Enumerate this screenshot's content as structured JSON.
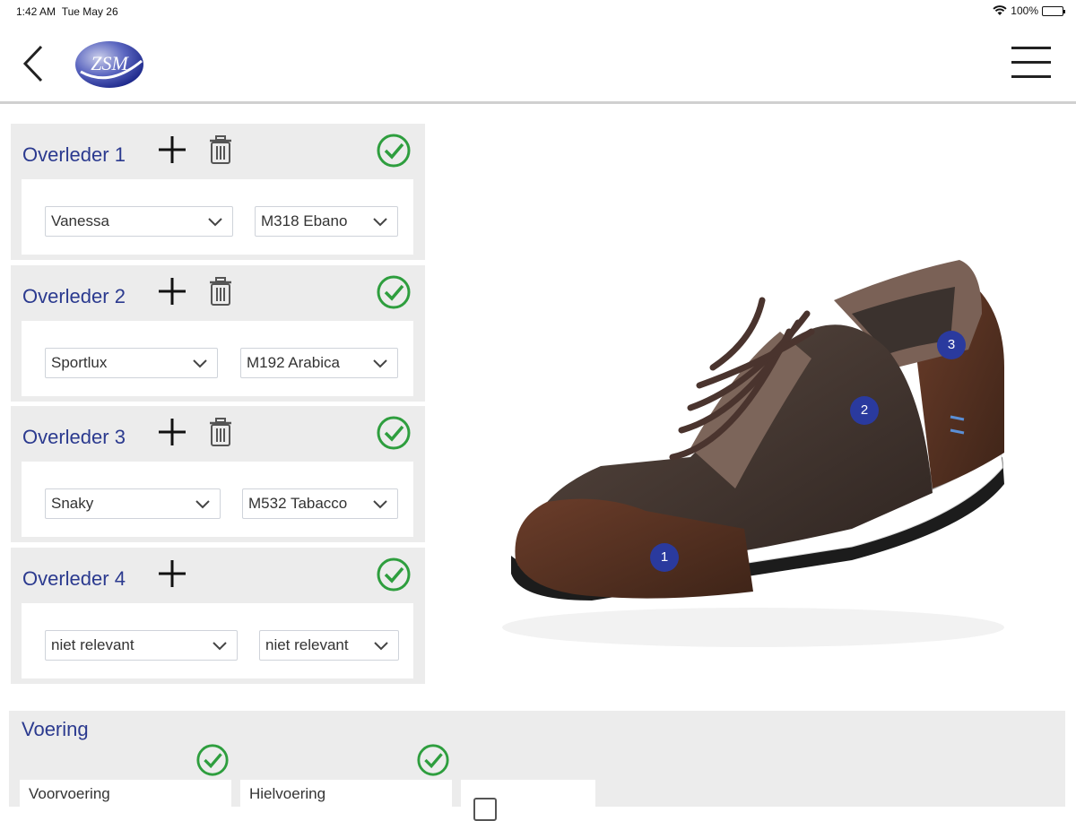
{
  "status_bar": {
    "time": "1:42 AM",
    "date": "Tue May 26",
    "battery": "100%"
  },
  "header": {
    "logo_text": "ZSM"
  },
  "panels": [
    {
      "title": "Overleder 1",
      "has_delete": true,
      "select_a": "Vanessa",
      "select_b": "M318 Ebano"
    },
    {
      "title": "Overleder 2",
      "has_delete": true,
      "select_a": "Sportlux",
      "select_b": "M192 Arabica"
    },
    {
      "title": "Overleder 3",
      "has_delete": true,
      "select_a": "Snaky",
      "select_b": "M532 Tabacco"
    },
    {
      "title": "Overleder 4",
      "has_delete": false,
      "select_a": "niet relevant",
      "select_b": "niet relevant"
    }
  ],
  "voering": {
    "title": "Voering",
    "cards": [
      "Voorvoering",
      "Hielvoering"
    ]
  },
  "markers": [
    "1",
    "2",
    "3"
  ],
  "colors": {
    "accent": "#2b3a8f",
    "check": "#2e9e3e",
    "panel_bg": "#ececec",
    "marker": "#2a3a9e"
  }
}
